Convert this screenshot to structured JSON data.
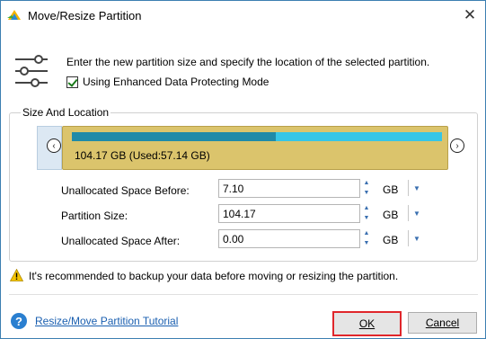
{
  "window": {
    "title": "Move/Resize Partition",
    "close_symbol": "✕"
  },
  "intro": {
    "description": "Enter the new partition size and specify the location of the selected partition.",
    "checkbox_label": "Using Enhanced Data Protecting Mode",
    "checkbox_checked": true
  },
  "size_location": {
    "group_title": "Size And Location",
    "partition_label": "104.17 GB (Used:57.14 GB)",
    "used_fraction": 0.55,
    "nav_left_symbol": "‹",
    "nav_right_symbol": "›"
  },
  "fields": [
    {
      "label": "Unallocated Space Before:",
      "value": "7.10",
      "unit": "GB"
    },
    {
      "label": "Partition Size:",
      "value": "104.17",
      "unit": "GB"
    },
    {
      "label": "Unallocated Space After:",
      "value": "0.00",
      "unit": "GB"
    }
  ],
  "warning": {
    "text": "It's recommended to backup your data before moving or resizing the partition."
  },
  "footer": {
    "help_symbol": "?",
    "tutorial_link": "Resize/Move Partition Tutorial",
    "ok_label": "OK",
    "cancel_label": "Cancel"
  },
  "colors": {
    "partition_fill": "#dbc46c",
    "used_bar": "#1f8aa8",
    "free_bar": "#36c6e6",
    "ok_highlight": "#e0262b",
    "link": "#1a5fb0"
  }
}
